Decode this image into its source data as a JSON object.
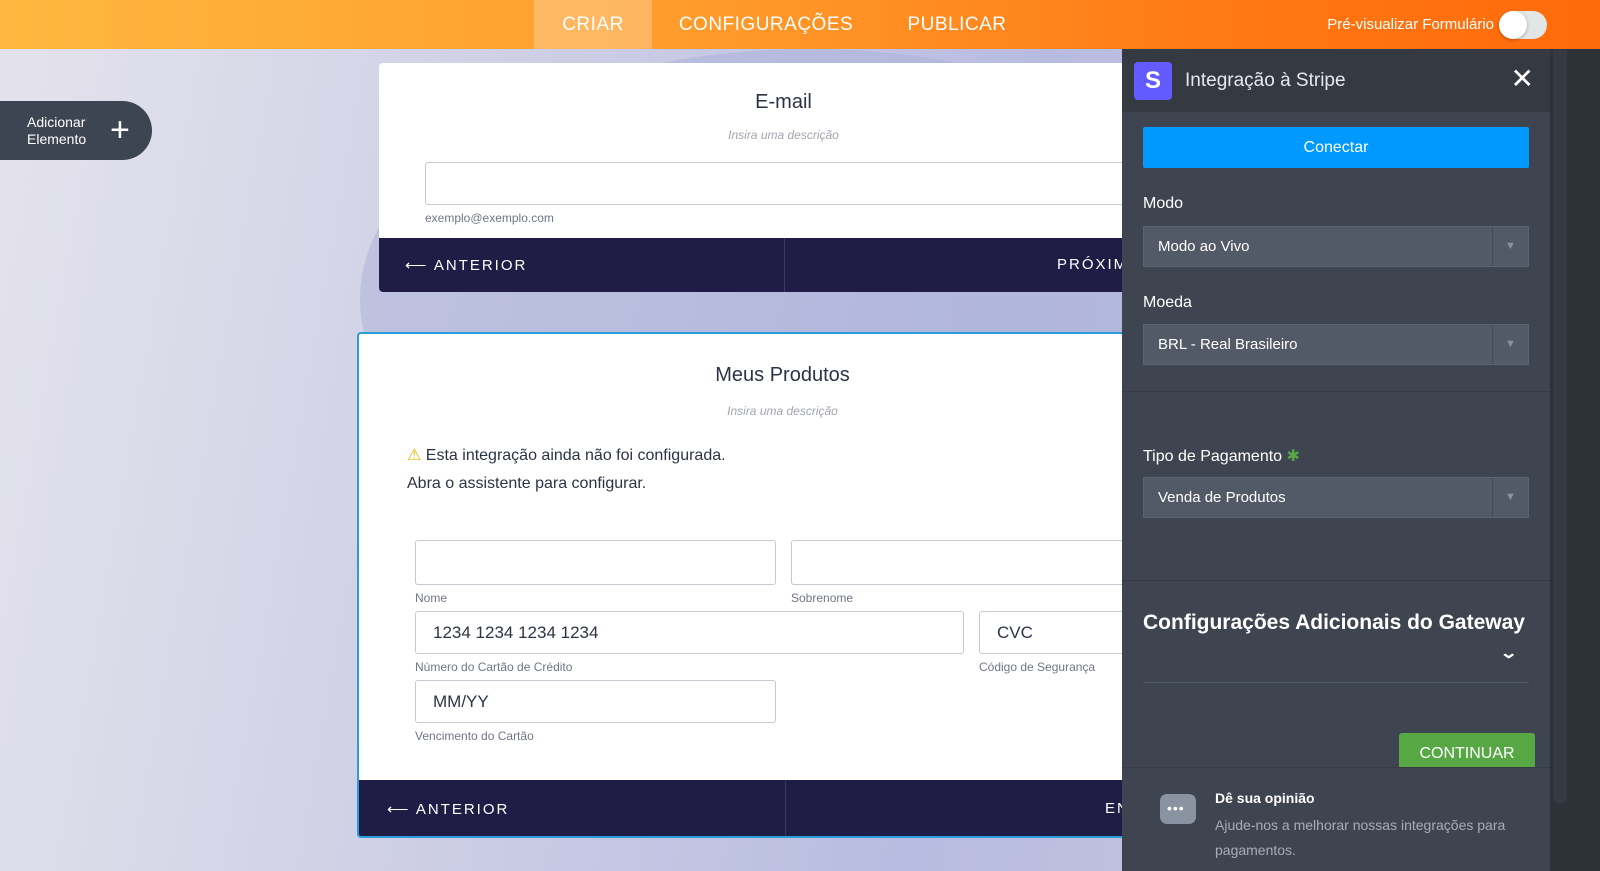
{
  "topbar": {
    "tabs": [
      {
        "label": "CRIAR",
        "active": true
      },
      {
        "label": "CONFIGURAÇÕES"
      },
      {
        "label": "PUBLICAR"
      }
    ],
    "preview_label": "Pré-visualizar Formulário",
    "preview_on": false
  },
  "add_element": {
    "line1": "Adicionar",
    "line2": "Elemento"
  },
  "email_card": {
    "title": "E-mail",
    "description": "Insira uma descrição",
    "sublabel": "exemplo@exemplo.com",
    "prev": "ANTERIOR",
    "next": "PRÓXIM"
  },
  "products_card": {
    "title": "Meus Produtos",
    "description": "Insira uma descrição",
    "warning_line1": "Esta integração ainda não foi configurada.",
    "warning_line2": "Abra o assistente para configurar.",
    "first_name_label": "Nome",
    "last_name_label": "Sobrenome",
    "card_number_placeholder": "1234 1234 1234 1234",
    "card_number_label": "Número do Cartão de Crédito",
    "cvc_placeholder": "CVC",
    "cvc_label": "Código de Segurança",
    "expiry_placeholder": "MM/YY",
    "expiry_label": "Vencimento do Cartão",
    "prev": "ANTERIOR",
    "next": "EN"
  },
  "panel": {
    "logo": "S",
    "title": "Integração à Stripe",
    "connect": "Conectar",
    "mode_label": "Modo",
    "mode_value": "Modo ao Vivo",
    "currency_label": "Moeda",
    "currency_value": "BRL - Real Brasileiro",
    "payment_type_label": "Tipo de Pagamento",
    "required_mark": "✱",
    "payment_type_value": "Venda de Produtos",
    "gateway_title": "Configurações Adicionais do Gateway",
    "continue": "CONTINUAR",
    "feedback_title": "Dê sua opinião",
    "feedback_desc": "Ajude-nos a melhorar nossas integrações para pagamentos."
  },
  "colors": {
    "accent": "#ff7a15",
    "connect": "#0099ff",
    "continue": "#57a845",
    "stripe": "#635bff",
    "navbar": "#1f1d45"
  }
}
